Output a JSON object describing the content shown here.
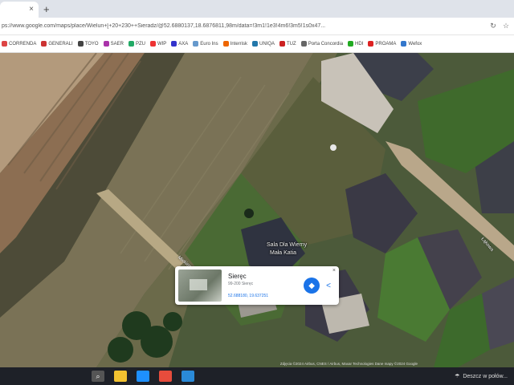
{
  "browser": {
    "tab_title": "",
    "tab_close": "×",
    "new_tab": "+",
    "url": "ps://www.google.com/maps/place/Wielun+[+20+230++Sieradz/@52.6880137,18.6876811,98m/data=!3m1!1e3!4m6!3m5!1s0x47...",
    "refresh_icon": "↻",
    "star_icon": "☆",
    "bookmarks": [
      {
        "label": "CORRENDA",
        "color": "#d44"
      },
      {
        "label": "GENERALI",
        "color": "#c33"
      },
      {
        "label": "TOYO",
        "color": "#444"
      },
      {
        "label": "SAER",
        "color": "#a3a"
      },
      {
        "label": "PZU",
        "color": "#2a6"
      },
      {
        "label": "WIP",
        "color": "#e33"
      },
      {
        "label": "AXA",
        "color": "#33c"
      },
      {
        "label": "Euro Ins",
        "color": "#69c"
      },
      {
        "label": "Interrisk",
        "color": "#e60"
      },
      {
        "label": "UNIQA",
        "color": "#27a"
      },
      {
        "label": "TUZ",
        "color": "#c22"
      },
      {
        "label": "Porta Concordia",
        "color": "#666"
      },
      {
        "label": "HDI",
        "color": "#2a2"
      },
      {
        "label": "PROAMA",
        "color": "#d22"
      },
      {
        "label": "Wefox",
        "color": "#37c"
      }
    ]
  },
  "map": {
    "place_label_line1": "Sala Dla Wierny",
    "place_label_line2": "Mała Katia",
    "road_label_1": "Mickiewicza",
    "road_label_2": "Łąkowa",
    "attribution": "Zdjęcia ©2024 Airbus, CNES / Airbus, Maxar Technologies Dane mapy ©2024 Google"
  },
  "info_card": {
    "title": "Sieręc",
    "subtitle": "99-200 Sieręc",
    "coordinates": "52.688180, 19.637251",
    "directions_icon": "◆",
    "share_icon": "<",
    "close_icon": "×"
  },
  "taskbar": {
    "weather_text": "Deszcz w połów...",
    "icons": [
      {
        "name": "search",
        "color": "#555",
        "glyph": "⌕"
      },
      {
        "name": "files",
        "color": "#f2c230",
        "glyph": ""
      },
      {
        "name": "edge",
        "color": "#1e90ff",
        "glyph": ""
      },
      {
        "name": "chrome",
        "color": "#e74c3c",
        "glyph": ""
      },
      {
        "name": "mail",
        "color": "#2a8ad8",
        "glyph": ""
      }
    ]
  }
}
